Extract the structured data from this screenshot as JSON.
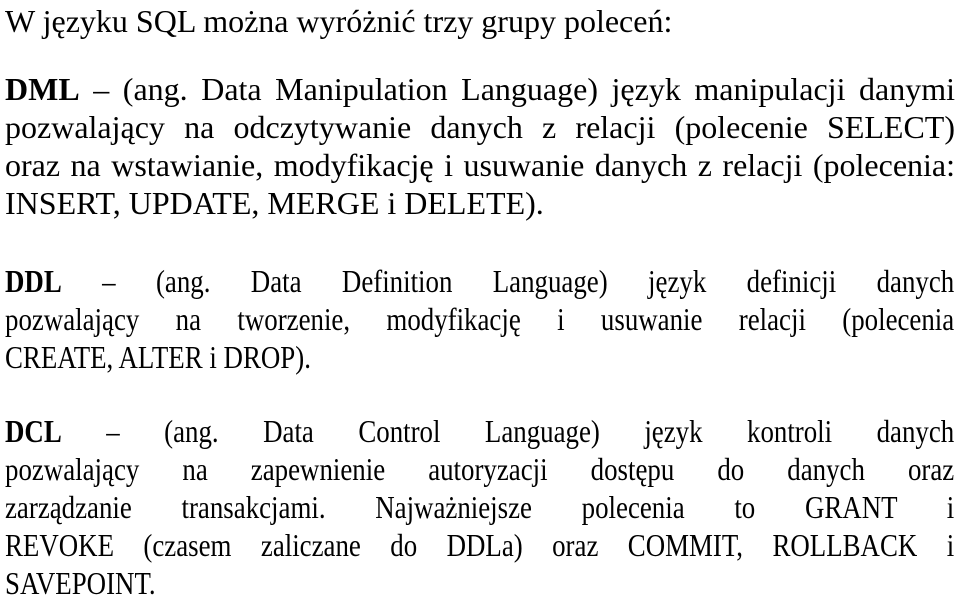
{
  "intro": "W języku SQL można wyróżnić trzy grupy poleceń:",
  "dml": {
    "term": "DML",
    "dash": "–",
    "lines": [
      "(ang. Data Manipulation Language) język manipulacji danymi",
      "pozwalający na odczytywanie danych z relacji (polecenie SELECT)",
      "oraz na wstawianie, modyfikację i usuwanie danych z relacji (polecenia:",
      "INSERT, UPDATE, MERGE i DELETE)."
    ]
  },
  "ddl": {
    "term": "DDL",
    "dash": "–",
    "lines": [
      "(ang. Data Definition Language) język definicji danych",
      "pozwalający na tworzenie, modyfikację i usuwanie relacji (polecenia",
      "CREATE, ALTER i DROP)."
    ]
  },
  "dcl": {
    "term": "DCL",
    "dash": "–",
    "lines": [
      "(ang. Data Control Language) język kontroli danych",
      "pozwalający na zapewnienie autoryzacji dostępu do danych oraz",
      "zarządzanie transakcjami. Najważniejsze polecenia to GRANT i",
      "REVOKE (czasem zaliczane do DDLa) oraz COMMIT, ROLLBACK i",
      "SAVEPOINT."
    ]
  }
}
